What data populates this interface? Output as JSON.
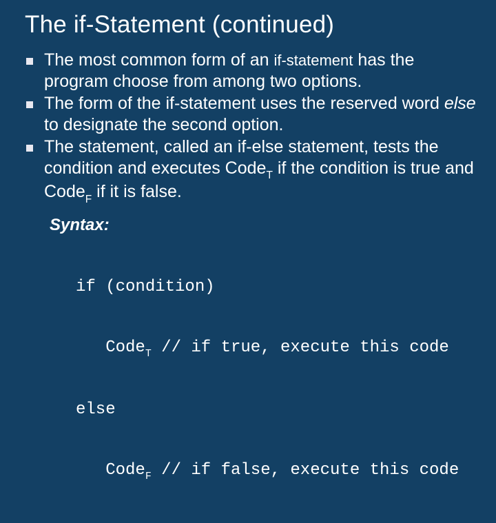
{
  "title": "The if-Statement (continued)",
  "bullets": {
    "b1": {
      "pre": "The most common form of an ",
      "code": "if-statement",
      "post": " has the program choose from among two options."
    },
    "b2": {
      "pre": "The form of the if-statement uses the reserved word ",
      "ital": "else",
      "post": " to designate the second option."
    },
    "b3": {
      "a": "The statement, called an if-else statement, tests the condition and executes Code",
      "sub1": "T",
      "b": " if the condition is true and Code",
      "sub2": "F",
      "c": " if it is false."
    }
  },
  "syntax_label": "Syntax:",
  "code": {
    "l1": "if (condition)",
    "l2a": "   Code",
    "l2sub": "T",
    "l2b": " // if true, execute this code",
    "l3": "else",
    "l4a": "   Code",
    "l4sub": "F",
    "l4b": " // if false, execute this code"
  }
}
